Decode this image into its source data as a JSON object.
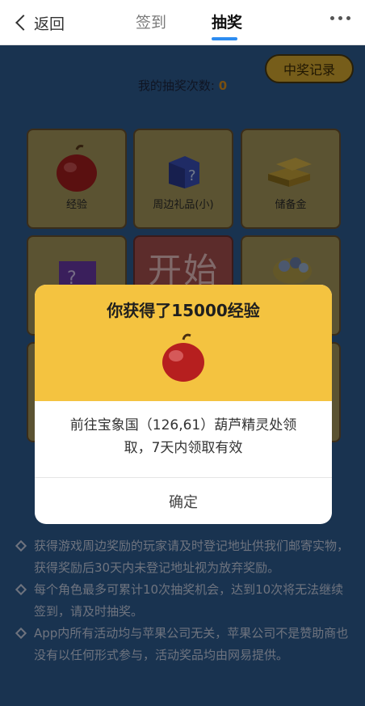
{
  "header": {
    "back_label": "返回",
    "tabs": [
      {
        "label": "签到",
        "active": false
      },
      {
        "label": "抽奖",
        "active": true
      }
    ]
  },
  "lottery": {
    "record_button": "中奖记录",
    "count_label": "我的抽奖次数:",
    "count_value": "0",
    "start_label": "开始",
    "prizes": [
      {
        "label": "经验",
        "icon": "apple-icon"
      },
      {
        "label": "周边礼品(小)",
        "icon": "mystery-box-icon"
      },
      {
        "label": "储备金",
        "icon": "gold-bars-icon"
      },
      {
        "label": "",
        "icon": "mystery-box-large-icon"
      },
      {
        "label": "",
        "icon": "treasure-pot-icon"
      }
    ]
  },
  "rules": [
    "获得游戏周边奖励的玩家请及时登记地址供我们邮寄实物，获得奖励后30天内未登记地址视为放弃奖励。",
    "每个角色最多可累计10次抽奖机会，达到10次将无法继续签到，请及时抽奖。",
    "App内所有活动均与苹果公司无关，苹果公司不是赞助商也没有以任何形式参与，活动奖品均由网易提供。"
  ],
  "modal": {
    "title": "你获得了15000经验",
    "prize_icon": "apple-icon",
    "description": "前往宝象国（126,61）葫芦精灵处领取，7天内领取有效",
    "confirm_label": "确定"
  },
  "colors": {
    "page_bg": "#2f5d93",
    "modal_header": "#f4c340",
    "accent_tab": "#2d8cf0",
    "count_value": "#d99020"
  }
}
